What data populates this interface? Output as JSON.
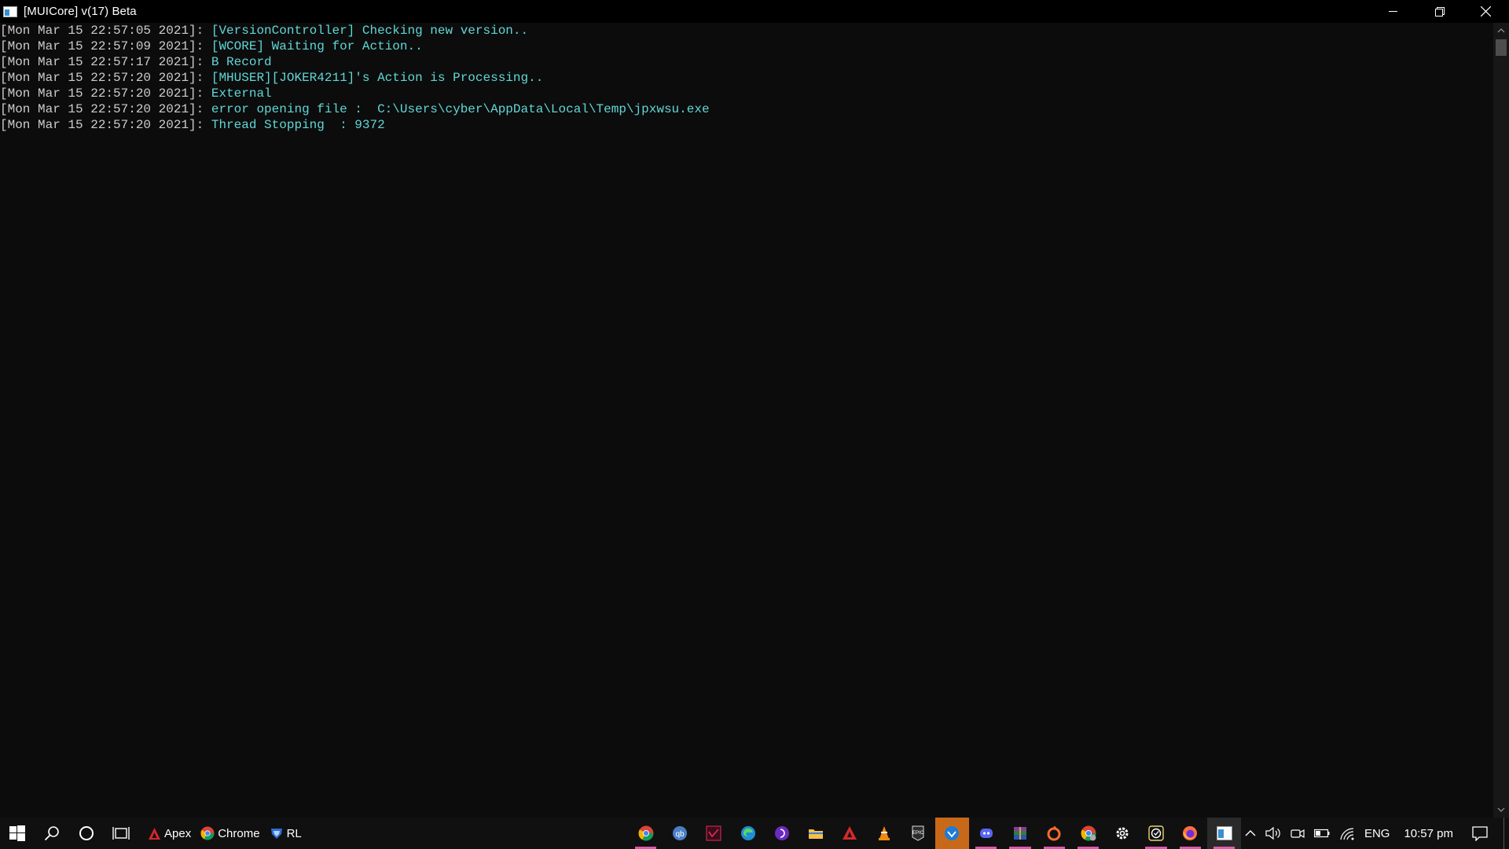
{
  "window": {
    "title": "[MUICore] v(17) Beta"
  },
  "console": {
    "lines": [
      {
        "timestamp": "[Mon Mar 15 22:57:05 2021]: ",
        "message": "[VersionController] Checking new version.."
      },
      {
        "timestamp": "[Mon Mar 15 22:57:09 2021]: ",
        "message": "[WCORE] Waiting for Action.."
      },
      {
        "timestamp": "[Mon Mar 15 22:57:17 2021]: ",
        "message": "B Record"
      },
      {
        "timestamp": "[Mon Mar 15 22:57:20 2021]: ",
        "message": "[MHUSER][JOKER4211]'s Action is Processing.."
      },
      {
        "timestamp": "[Mon Mar 15 22:57:20 2021]: ",
        "message": "External"
      },
      {
        "timestamp": "[Mon Mar 15 22:57:20 2021]: ",
        "message": "error opening file :  C:\\Users\\cyber\\AppData\\Local\\Temp\\jpxwsu.exe"
      },
      {
        "timestamp": "[Mon Mar 15 22:57:20 2021]: ",
        "message": "Thread Stopping  : 9372"
      }
    ],
    "colors": {
      "timestamp": "#cccccc",
      "message": "#61d6d6",
      "background": "#0c0c0c"
    }
  },
  "taskbar": {
    "pinned": [
      {
        "label": "Apex",
        "icon": "apex-icon"
      },
      {
        "label": "Chrome",
        "icon": "chrome-icon"
      },
      {
        "label": "RL",
        "icon": "rocket-league-icon"
      }
    ],
    "apps": [
      {
        "icon": "chrome-icon"
      },
      {
        "icon": "qbittorrent-icon"
      },
      {
        "icon": "sketch-app-icon"
      },
      {
        "icon": "edge-icon"
      },
      {
        "icon": "podcast-icon"
      },
      {
        "icon": "file-explorer-icon"
      },
      {
        "icon": "acrobat-icon"
      },
      {
        "icon": "vlc-icon"
      },
      {
        "icon": "epic-games-icon"
      },
      {
        "icon": "vpn-icon"
      },
      {
        "icon": "discord-icon"
      },
      {
        "icon": "winrar-icon"
      },
      {
        "icon": "origin-icon"
      },
      {
        "icon": "chrome-profile-icon"
      },
      {
        "icon": "settings-icon"
      },
      {
        "icon": "clock-app-icon"
      },
      {
        "icon": "firefox-icon"
      },
      {
        "icon": "console-icon"
      }
    ],
    "tray": {
      "language": "ENG",
      "time": "10:57 pm"
    }
  }
}
